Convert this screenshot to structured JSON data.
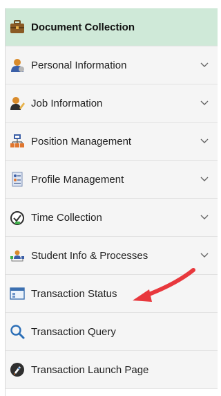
{
  "nav": {
    "items": [
      {
        "label": "Document Collection",
        "icon": "briefcase-icon",
        "expandable": false,
        "active": true
      },
      {
        "label": "Personal Information",
        "icon": "person-icon",
        "expandable": true
      },
      {
        "label": "Job Information",
        "icon": "person-pencil-icon",
        "expandable": true
      },
      {
        "label": "Position Management",
        "icon": "org-chart-icon",
        "expandable": true
      },
      {
        "label": "Profile Management",
        "icon": "profile-list-icon",
        "expandable": true
      },
      {
        "label": "Time Collection",
        "icon": "stopwatch-icon",
        "expandable": true
      },
      {
        "label": "Student Info & Processes",
        "icon": "student-network-icon",
        "expandable": true
      },
      {
        "label": "Transaction Status",
        "icon": "window-status-icon",
        "expandable": false
      },
      {
        "label": "Transaction Query",
        "icon": "magnifier-icon",
        "expandable": false
      },
      {
        "label": "Transaction Launch Page",
        "icon": "rocket-icon",
        "expandable": false
      }
    ]
  },
  "colors": {
    "active_bg": "#cfe9d8",
    "item_bg": "#f5f5f5",
    "arrow": "#e8383d"
  }
}
